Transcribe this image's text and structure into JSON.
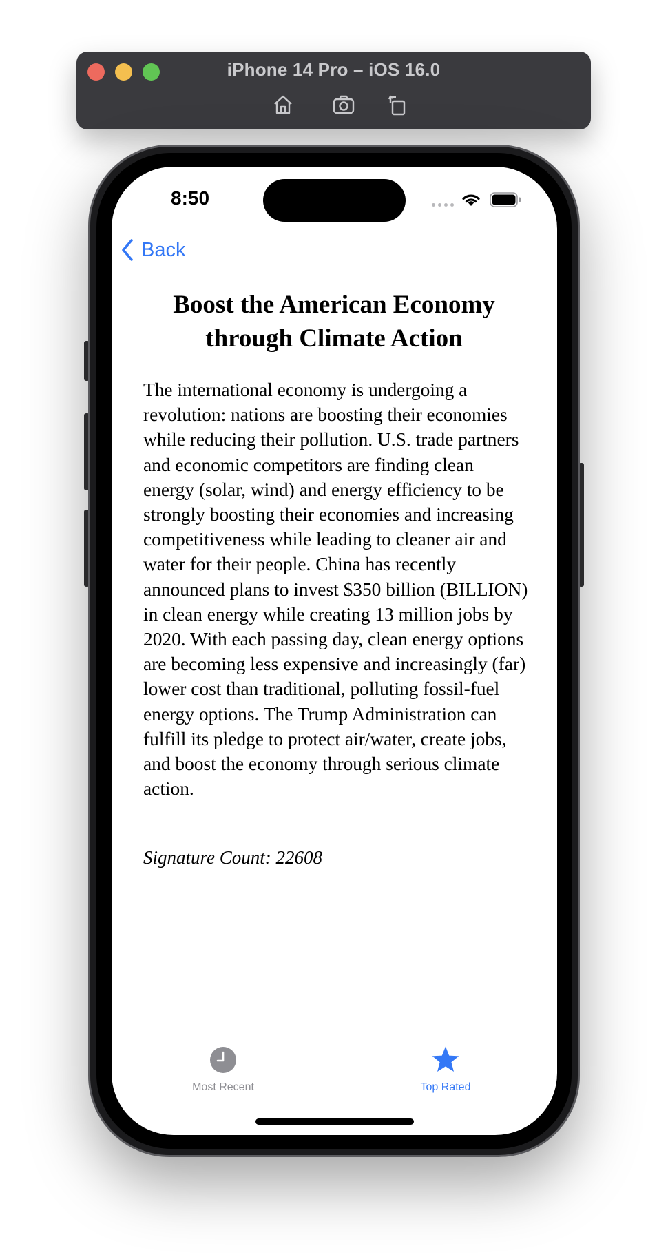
{
  "simulator": {
    "title": "iPhone 14 Pro – iOS 16.0",
    "buttons": [
      {
        "icon": "home-icon"
      },
      {
        "icon": "screenshot-icon"
      },
      {
        "icon": "rotate-icon"
      }
    ]
  },
  "status_bar": {
    "time": "8:50",
    "icons": [
      "cellular-dots-icon",
      "wifi-icon",
      "battery-icon"
    ]
  },
  "nav": {
    "back_label": "Back"
  },
  "petition": {
    "title": "Boost the American Economy through Climate Action",
    "body": "The international economy is undergoing a revolution: nations are boosting their economies while reducing their pollution. U.S. trade partners and economic competitors are finding clean energy (solar, wind) and energy efficiency to be strongly boosting their economies and increasing competitiveness while leading to cleaner air and water for their people. China has recently announced plans to invest $350 billion (BILLION) in clean energy while creating 13 million jobs by 2020. With each passing day, clean energy options are becoming less expensive and increasingly (far) lower cost than traditional, polluting fossil-fuel energy options. The Trump Administration can fulfill its pledge to protect air/water, create jobs, and boost the economy through serious climate action.",
    "signature_count": "Signature Count: 22608"
  },
  "tab_bar": {
    "tabs": [
      {
        "label": "Most Recent",
        "icon": "clock-icon",
        "selected": false
      },
      {
        "label": "Top Rated",
        "icon": "star-icon",
        "selected": true
      }
    ]
  },
  "colors": {
    "accent": "#3478f6",
    "inactive_tab": "#8e8e93",
    "simulator_bar": "#3a3a3e"
  }
}
